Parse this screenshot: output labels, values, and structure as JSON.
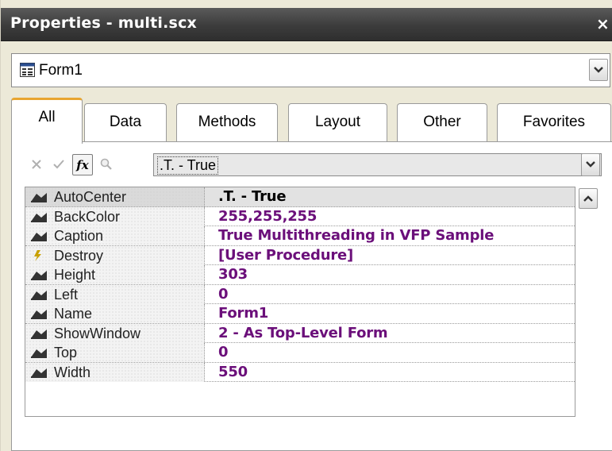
{
  "window": {
    "title": "Properties - multi.scx",
    "close_label": "×"
  },
  "object_selector": {
    "value": "Form1"
  },
  "tabs": [
    {
      "label": "All",
      "active": true
    },
    {
      "label": "Data",
      "active": false
    },
    {
      "label": "Methods",
      "active": false
    },
    {
      "label": "Layout",
      "active": false
    },
    {
      "label": "Other",
      "active": false
    },
    {
      "label": "Favorites",
      "active": false
    }
  ],
  "toolbar": {
    "cancel_icon": "x-icon",
    "accept_icon": "check-icon",
    "function_label": "fx",
    "zoom_icon": "zoom-icon",
    "value_box": ".T. - True"
  },
  "properties": [
    {
      "name": "AutoCenter",
      "value": ".T. - True",
      "icon": "property-icon",
      "selected": true
    },
    {
      "name": "BackColor",
      "value": "255,255,255",
      "icon": "property-icon"
    },
    {
      "name": "Caption",
      "value": "True Multithreading in VFP Sample",
      "icon": "property-icon"
    },
    {
      "name": "Destroy",
      "value": "[User Procedure]",
      "icon": "method-icon"
    },
    {
      "name": "Height",
      "value": "303",
      "icon": "property-icon"
    },
    {
      "name": "Left",
      "value": "0",
      "icon": "property-icon"
    },
    {
      "name": "Name",
      "value": "Form1",
      "icon": "property-icon"
    },
    {
      "name": "ShowWindow",
      "value": "2 - As Top-Level Form",
      "icon": "property-icon"
    },
    {
      "name": "Top",
      "value": "0",
      "icon": "property-icon"
    },
    {
      "name": "Width",
      "value": "550",
      "icon": "property-icon"
    }
  ],
  "colors": {
    "value_text": "#6b0f7a",
    "active_tab_accent": "#e8a530",
    "titlebar": "#3c3c3c"
  }
}
